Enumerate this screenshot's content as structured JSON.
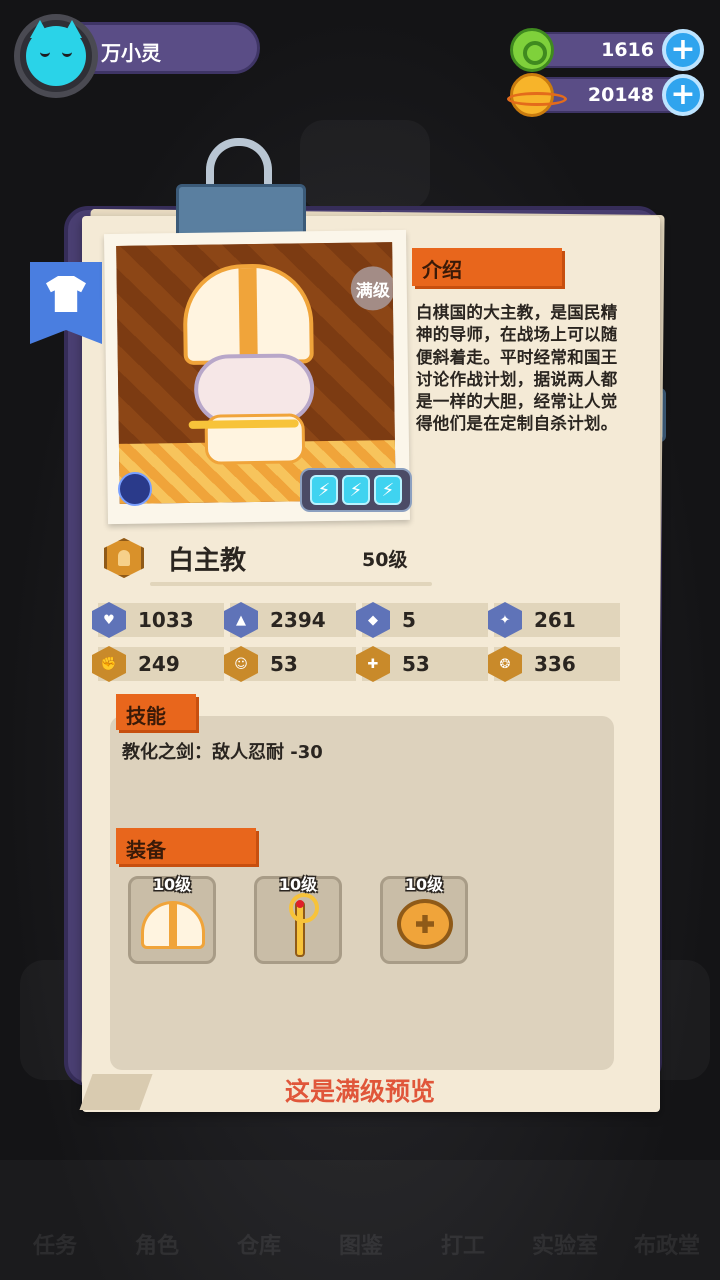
{
  "player": {
    "name": "万小灵"
  },
  "currencies": [
    {
      "icon": "green-gem-icon",
      "value": "1616"
    },
    {
      "icon": "gold-coin-icon",
      "value": "20148"
    }
  ],
  "character": {
    "max_badge": "满级",
    "name": "白主教",
    "level": "50级",
    "energy_icons": [
      "⚡",
      "⚡",
      "⚡"
    ]
  },
  "intro": {
    "label": "介绍",
    "text": "白棋国的大主教，是国民精神的导师，在战场上可以随便斜着走。平时经常和国王讨论作战计划，据说两人都是一样的大胆，经常让人觉得他们是在定制自杀计划。"
  },
  "stats": [
    {
      "icon": "heart-shield-icon",
      "value": "1033"
    },
    {
      "icon": "sword-attack-icon",
      "value": "2394"
    },
    {
      "icon": "shield-defense-icon",
      "value": "5"
    },
    {
      "icon": "crit-burst-icon",
      "value": "261"
    },
    {
      "icon": "strength-icon",
      "value": "249"
    },
    {
      "icon": "smile-icon",
      "value": "53"
    },
    {
      "icon": "muscle-icon",
      "value": "53"
    },
    {
      "icon": "brain-icon",
      "value": "336"
    }
  ],
  "skill": {
    "label": "技能",
    "text": "教化之剑：敌人忍耐 -30"
  },
  "equipment": {
    "label": "装备",
    "items": [
      {
        "name": "mitre-hat",
        "level": "10级"
      },
      {
        "name": "staff",
        "level": "10级"
      },
      {
        "name": "ring",
        "level": "10级"
      }
    ]
  },
  "footer_note": "这是满级预览",
  "background_nav": [
    "任务",
    "角色",
    "仓库",
    "图鉴",
    "打工",
    "实验室",
    "布政堂"
  ],
  "colors": {
    "accent_orange": "#e8661c",
    "board_purple": "#4a3f72",
    "paper": "#f4ead6",
    "note_red": "#e0563a"
  }
}
